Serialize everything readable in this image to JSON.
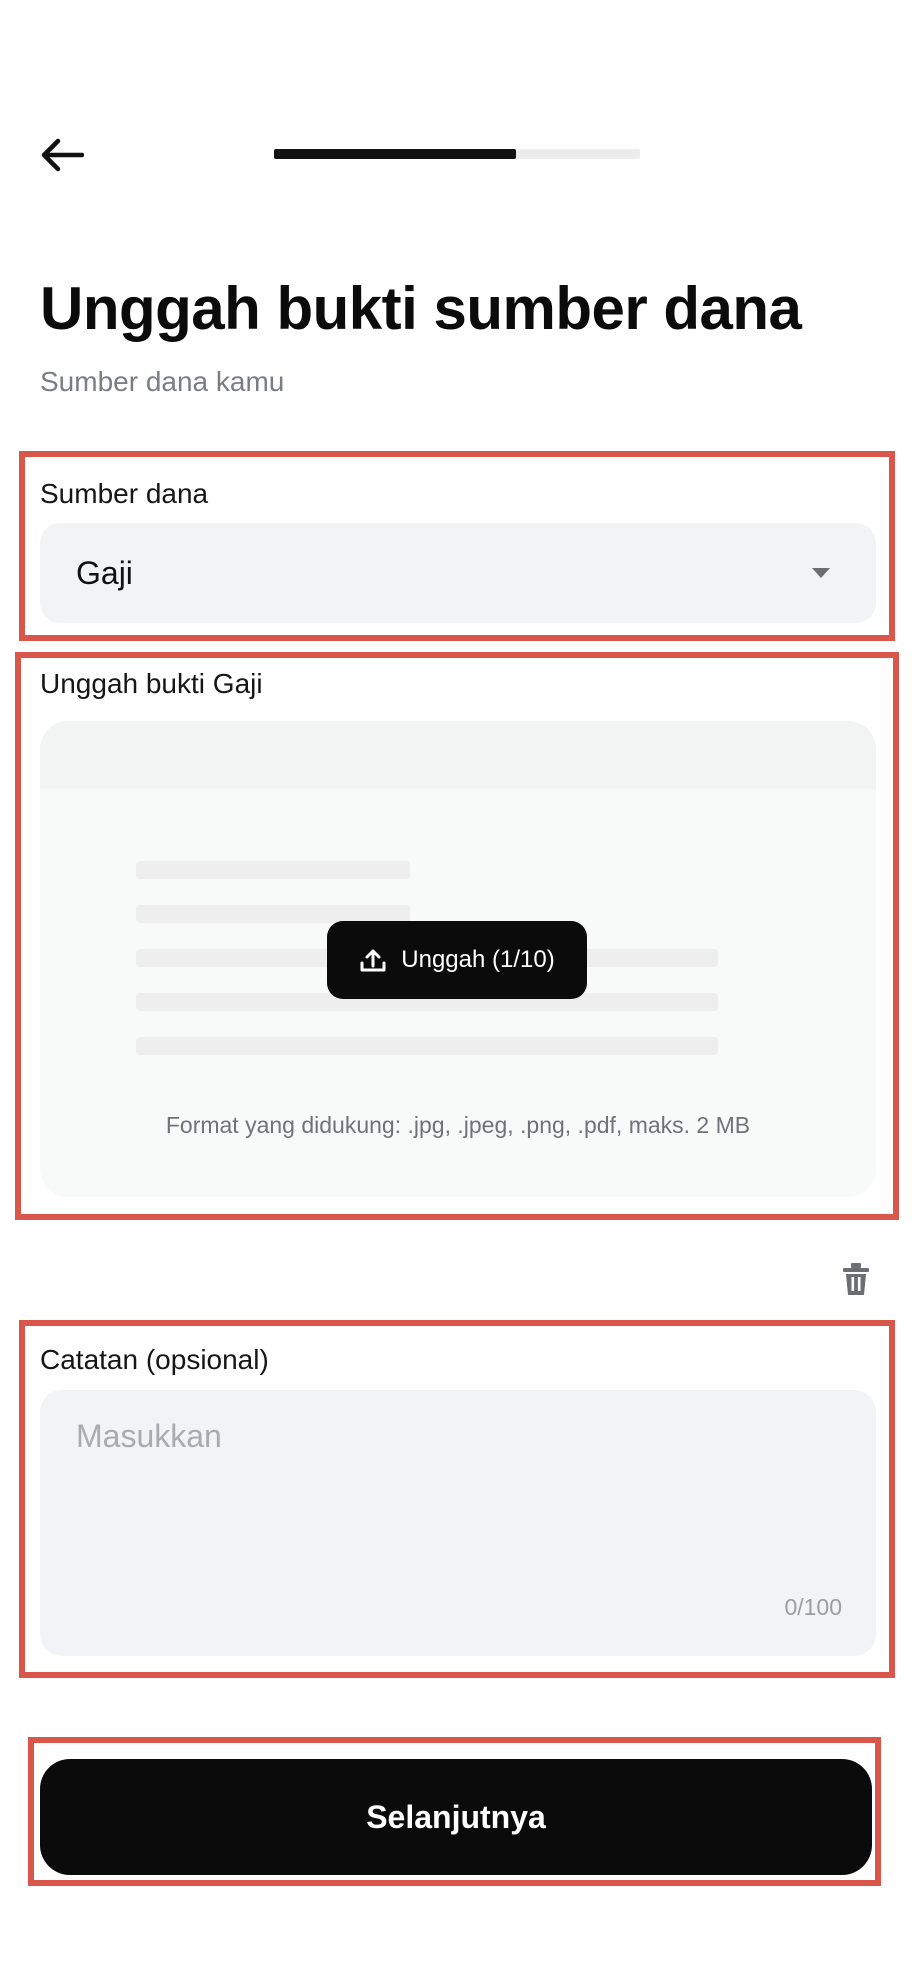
{
  "header": {
    "progress_fraction": 0.66
  },
  "title": "Unggah bukti sumber dana",
  "subtitle": "Sumber dana kamu",
  "source": {
    "label": "Sumber dana",
    "selected": "Gaji"
  },
  "upload": {
    "label": "Unggah bukti Gaji",
    "button_label": "Unggah (1/10)",
    "format_text": "Format yang didukung: .jpg, .jpeg, .png, .pdf, maks. 2 MB"
  },
  "note": {
    "label": "Catatan (opsional)",
    "placeholder": "Masukkan",
    "value": "",
    "counter": "0/100"
  },
  "next_button": "Selanjutnya",
  "icons": {
    "back": "arrow-left-icon",
    "caret": "caret-down-icon",
    "upload": "upload-icon",
    "trash": "trash-icon"
  },
  "colors": {
    "primary": "#0b0b0b",
    "field_bg": "#f1f3f5",
    "highlight": "#d9564a"
  }
}
